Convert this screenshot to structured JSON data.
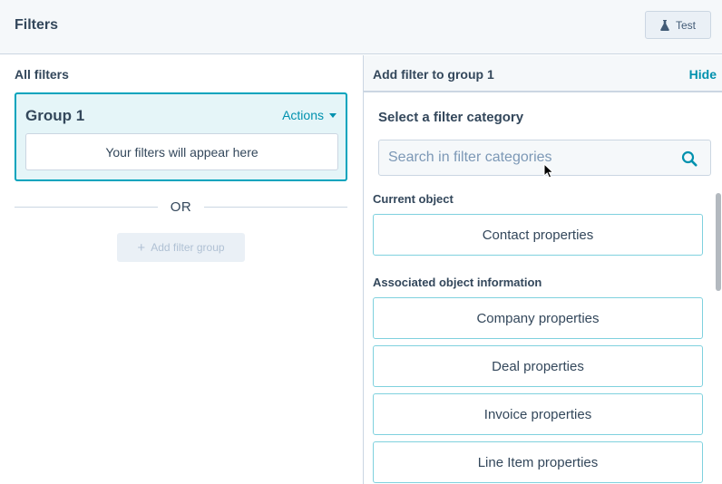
{
  "header": {
    "title": "Filters",
    "test_label": "Test",
    "test_icon": "flask-icon"
  },
  "left_panel": {
    "title": "All filters",
    "group": {
      "title": "Group 1",
      "actions_label": "Actions",
      "empty_text": "Your filters will appear here"
    },
    "or_label": "OR",
    "add_group_label": "Add filter group"
  },
  "right_panel": {
    "title": "Add filter to group 1",
    "hide_label": "Hide",
    "select_title": "Select a filter category",
    "search": {
      "placeholder": "Search in filter categories",
      "value": ""
    },
    "sections": [
      {
        "label": "Current object",
        "items": [
          "Contact properties"
        ]
      },
      {
        "label": "Associated object information",
        "items": [
          "Company properties",
          "Deal properties",
          "Invoice properties",
          "Line Item properties"
        ]
      }
    ]
  },
  "colors": {
    "accent": "#00a4bd",
    "link": "#0091ae",
    "text": "#33475b",
    "border": "#cbd6e2",
    "header_bg": "#f5f8fa",
    "group_bg": "#e5f5f8"
  }
}
